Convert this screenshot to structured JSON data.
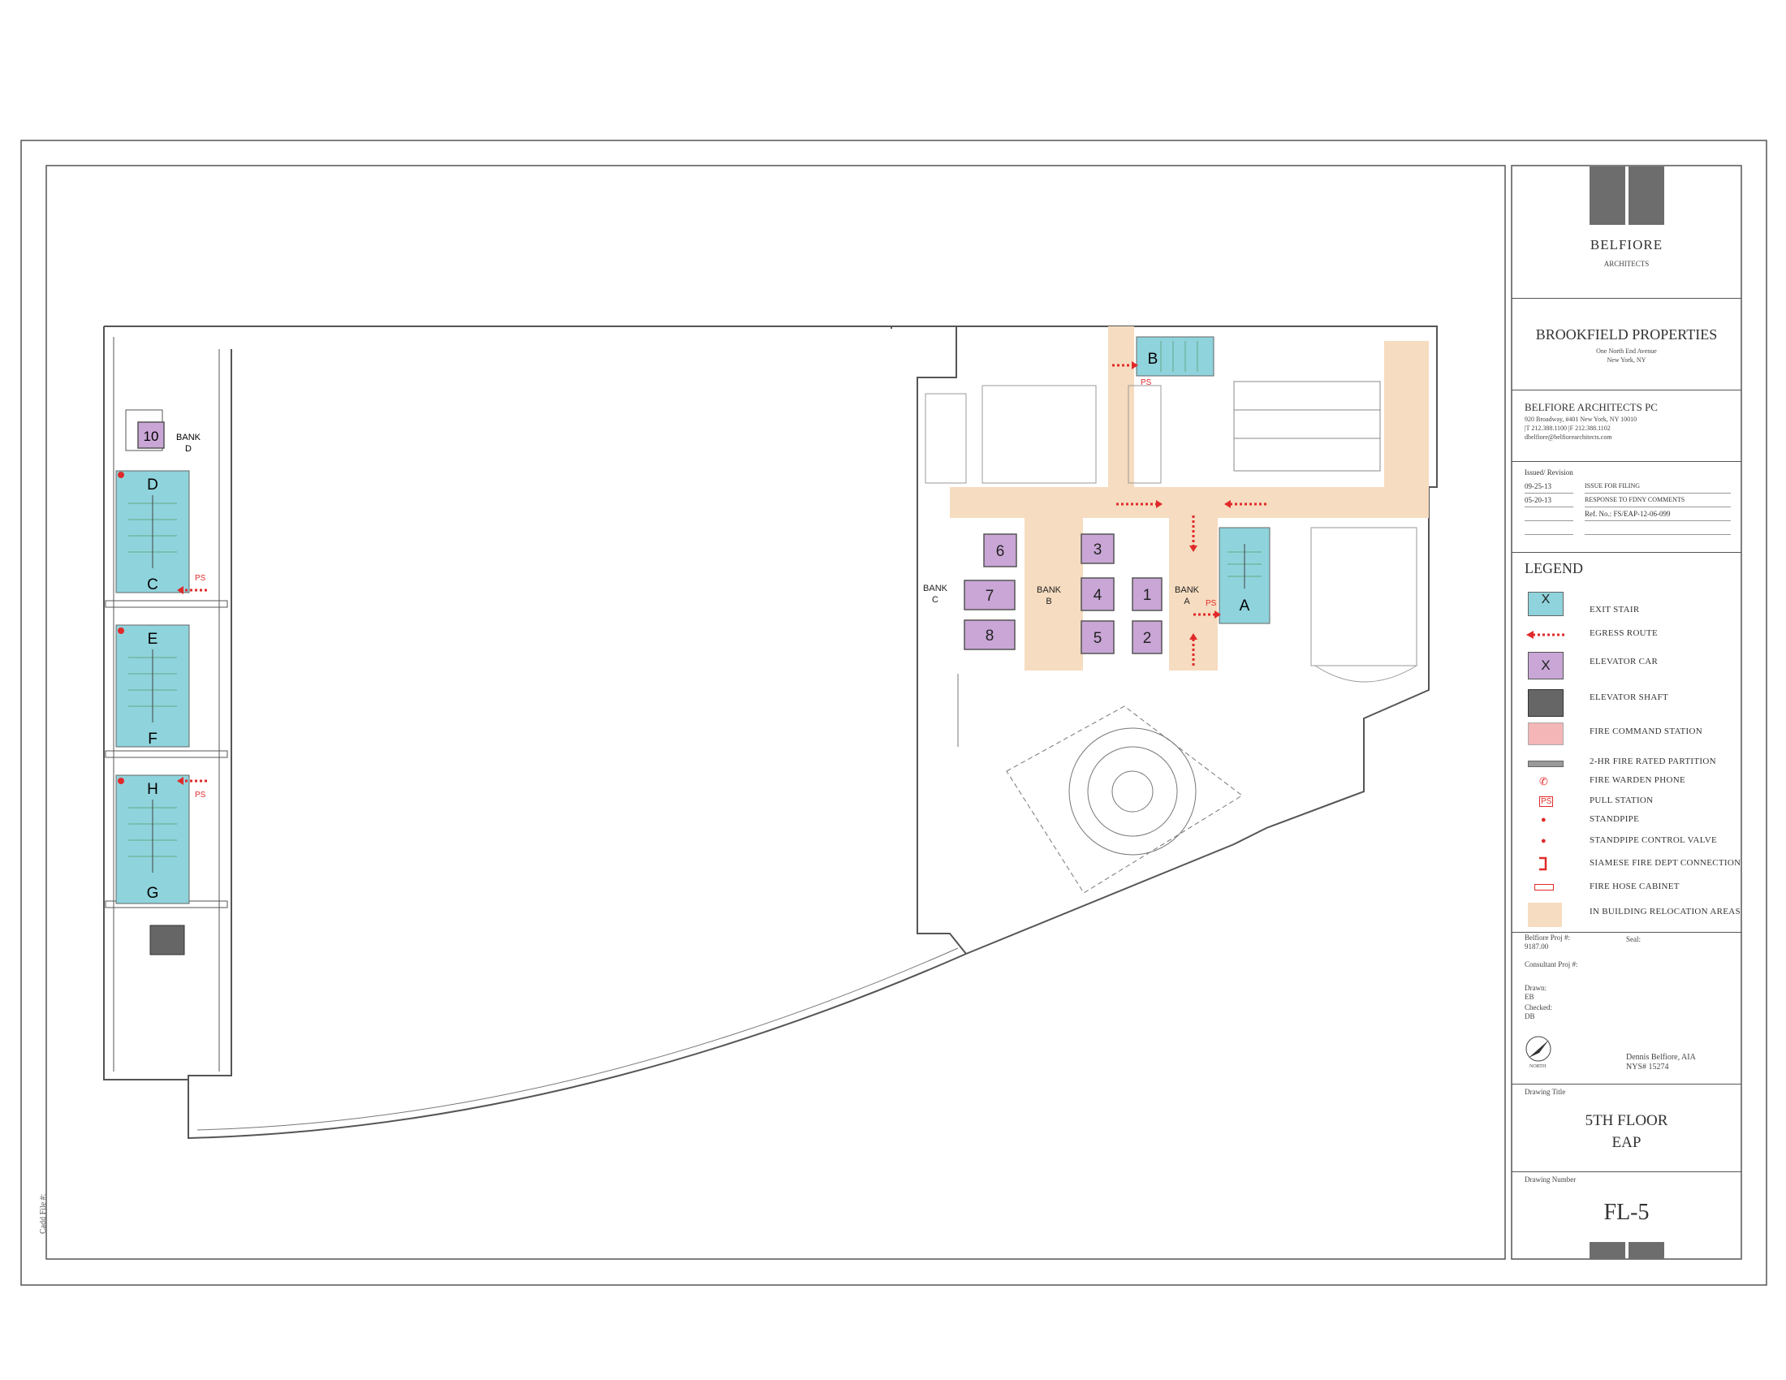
{
  "colors": {
    "stair": "#8fd3dc",
    "elevator": "#c9a6d6",
    "relocation": "#f6dcc0",
    "egress": "#e02a2a",
    "shaft": "#666666",
    "fire_command": "#f4b6b6",
    "partition": "#9a9a9a"
  },
  "titleblock": {
    "firm": "BELFIORE",
    "firm_sub": "ARCHITECTS",
    "client": "BROOKFIELD PROPERTIES",
    "client_addr1": "One North End Avenue",
    "client_addr2": "New York, NY",
    "office": "BELFIORE ARCHITECTS PC",
    "office_addr": "920 Broadway, #401   New York, NY 10010",
    "office_phone": "|T  212.388.1100   |F  212.388.1102",
    "office_email": "dbelfiore@belfiorearchitects.com",
    "issued_header": "Issued/ Revision",
    "rev1_date": "09-25-13",
    "rev1_text": "ISSUE FOR FILING",
    "rev2_date": "05-20-13",
    "rev2_text": "RESPONSE TO FDNY COMMENTS",
    "ref_no": "Ref. No.: FS/EAP-12-06-099",
    "legend_title": "LEGEND",
    "legend_items": [
      {
        "key": "exit-stair",
        "label": "EXIT STAIR",
        "glyph": "X"
      },
      {
        "key": "egress-route",
        "label": "EGRESS ROUTE",
        "glyph": ""
      },
      {
        "key": "elevator-car",
        "label": "ELEVATOR CAR",
        "glyph": "X"
      },
      {
        "key": "elevator-shaft",
        "label": "ELEVATOR SHAFT",
        "glyph": ""
      },
      {
        "key": "fire-command-station",
        "label": "FIRE COMMAND STATION",
        "glyph": ""
      },
      {
        "key": "fire-rated-partition",
        "label": "2-HR FIRE RATED PARTITION",
        "glyph": ""
      },
      {
        "key": "fire-warden-phone",
        "label": "FIRE WARDEN PHONE",
        "glyph": "✆"
      },
      {
        "key": "pull-station",
        "label": "PULL STATION",
        "glyph": "PS"
      },
      {
        "key": "standpipe",
        "label": "STANDPIPE",
        "glyph": "●"
      },
      {
        "key": "standpipe-control-valve",
        "label": "STANDPIPE CONTROL VALVE",
        "glyph": "●"
      },
      {
        "key": "siamese-connection",
        "label": "SIAMESE FIRE DEPT CONNECTION",
        "glyph": ""
      },
      {
        "key": "fire-hose-cabinet",
        "label": "FIRE HOSE CABINET",
        "glyph": ""
      },
      {
        "key": "relocation-areas",
        "label": "IN BUILDING RELOCATION AREAS",
        "glyph": ""
      }
    ],
    "proj_label": "Belfiore Proj #:",
    "proj_no": "9187.00",
    "seal_label": "Seal:",
    "consultant_label": "Consultant Proj #:",
    "drawn_label": "Drawn:",
    "drawn_by": "EB",
    "checked_label": "Checked:",
    "checked_by": "DB",
    "north_label": "NORTH",
    "architect_name": "Dennis Belfiore, AIA",
    "architect_lic": "NYS# 15274",
    "drawing_title_label": "Drawing Title",
    "drawing_title_1": "5TH FLOOR",
    "drawing_title_2": "EAP",
    "drawing_number_label": "Drawing Number",
    "drawing_number": "FL-5",
    "cadd_file": "Cadd File #:"
  },
  "plan": {
    "stairs": [
      "A",
      "B",
      "C",
      "D",
      "E",
      "F",
      "G",
      "H"
    ],
    "elevators": [
      "1",
      "2",
      "3",
      "4",
      "5",
      "6",
      "7",
      "8",
      "10"
    ],
    "bank_a": "BANK A",
    "bank_b": "BANK B",
    "bank_c": "BANK C",
    "bank_d": "BANK D",
    "ps": "PS"
  }
}
